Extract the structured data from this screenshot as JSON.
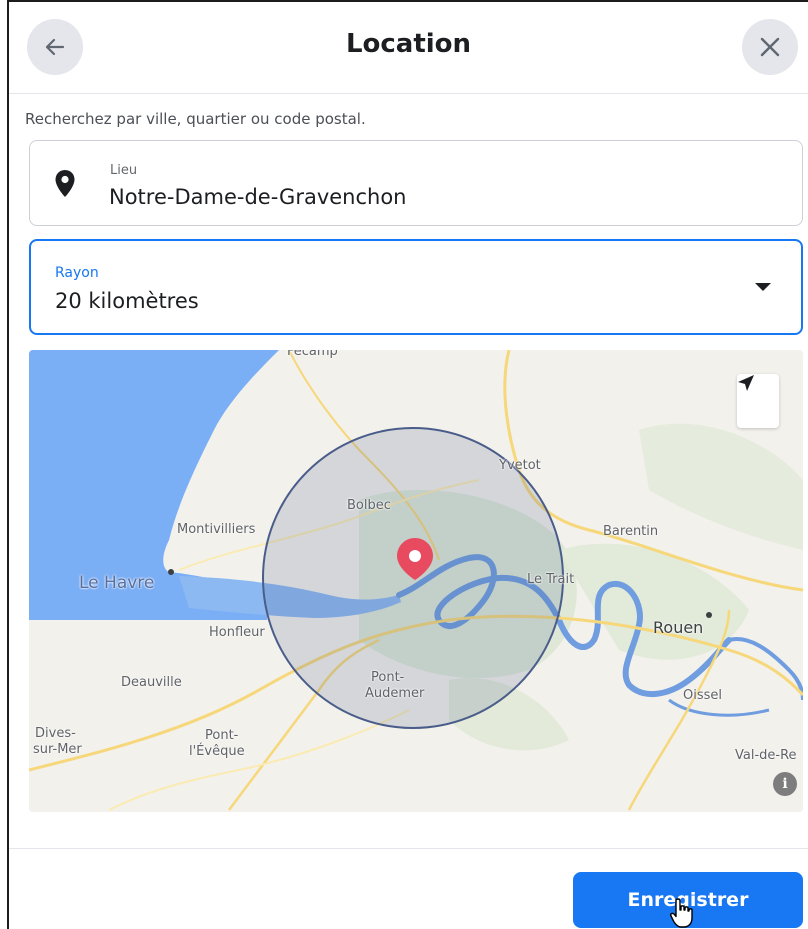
{
  "header": {
    "title": "Location",
    "back_icon": "arrow-left-icon",
    "close_icon": "close-icon"
  },
  "search": {
    "hint": "Recherchez par ville, quartier ou code postal."
  },
  "lieu": {
    "label": "Lieu",
    "value": "Notre-Dame-de-Gravenchon",
    "icon": "map-pin-icon"
  },
  "rayon": {
    "label": "Rayon",
    "value": "20 kilomètres"
  },
  "map": {
    "labels": {
      "fecamp": "Fécamp",
      "yvetot": "Yvetot",
      "bolbec": "Bolbec",
      "montivilliers": "Montivilliers",
      "barentin": "Barentin",
      "le_havre": "Le Havre",
      "le_trait": "Le Trait",
      "honfleur": "Honfleur",
      "rouen": "Rouen",
      "deauville": "Deauville",
      "pont_audemer_1": "Pont-",
      "pont_audemer_2": "Audemer",
      "oissel": "Oissel",
      "dives_1": "Dives-",
      "dives_2": "sur-Mer",
      "pont_eveque_1": "Pont-",
      "pont_eveque_2": "l'Évêque",
      "val_de_reuil": "Val-de-Re"
    },
    "info": "i",
    "colors": {
      "sea": "#7aaef5",
      "river": "#6f9de0",
      "radius": "#4a5d8a",
      "pin": "#e84a5f"
    }
  },
  "footer": {
    "save_label": "Enregistrer"
  },
  "colors": {
    "accent": "#1877f2"
  }
}
